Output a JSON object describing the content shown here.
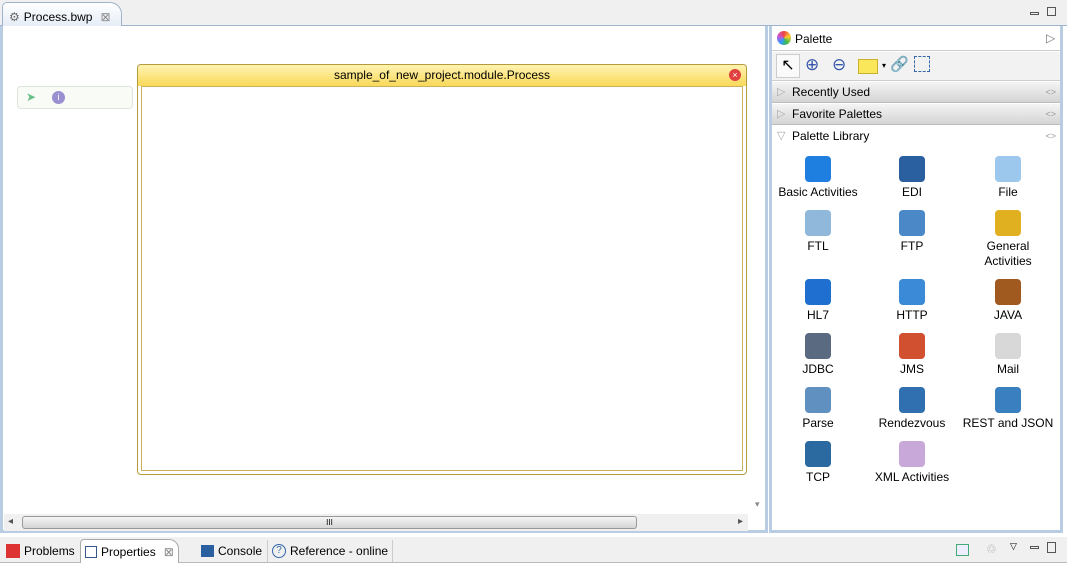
{
  "editor_tab": {
    "title": "Process.bwp",
    "close": "⊠"
  },
  "process": {
    "title": "sample_of_new_project.module.Process",
    "close": "×"
  },
  "scroll": {
    "thumb": "III",
    "left": "◂",
    "right": "▸",
    "down": "▾"
  },
  "palette": {
    "title": "Palette",
    "expand": "▷",
    "drawers": [
      {
        "label": "Recently Used"
      },
      {
        "label": "Favorite Palettes"
      },
      {
        "label": "Palette Library"
      }
    ],
    "items": [
      {
        "label": "Basic Activities",
        "icon": "play",
        "color": "#1f7fe0"
      },
      {
        "label": "EDI",
        "icon": "EDI",
        "color": "#2a5fa0"
      },
      {
        "label": "File",
        "icon": "file",
        "color": "#9cc8ee"
      },
      {
        "label": "FTL",
        "icon": "cubes",
        "color": "#8fb8da"
      },
      {
        "label": "FTP",
        "icon": "FTP",
        "color": "#4a88c8"
      },
      {
        "label": "General Activities",
        "icon": "gears",
        "color": "#e0b020"
      },
      {
        "label": "HL7",
        "icon": "caduceus",
        "color": "#1e6fd0"
      },
      {
        "label": "HTTP",
        "icon": "globe",
        "color": "#3a8ad8"
      },
      {
        "label": "JAVA",
        "icon": "cup",
        "color": "#a05a20"
      },
      {
        "label": "JDBC",
        "icon": "SQL",
        "color": "#5a6a80"
      },
      {
        "label": "JMS",
        "icon": "cup",
        "color": "#d05030"
      },
      {
        "label": "Mail",
        "icon": "envelope",
        "color": "#d8d8d8"
      },
      {
        "label": "Parse",
        "icon": "magnifier",
        "color": "#6090c0"
      },
      {
        "label": "Rendezvous",
        "icon": "arrow",
        "color": "#3070b0"
      },
      {
        "label": "REST and JSON",
        "icon": "globe-arrows",
        "color": "#3a80c0"
      },
      {
        "label": "TCP",
        "icon": "monitor",
        "color": "#2a6aa0"
      },
      {
        "label": "XML Activities",
        "icon": "xml",
        "color": "#c8a8d8"
      }
    ]
  },
  "bottom_tabs": [
    {
      "label": "Problems"
    },
    {
      "label": "Properties",
      "close": "⊠"
    },
    {
      "label": "Console"
    },
    {
      "label": "Reference - online"
    }
  ]
}
